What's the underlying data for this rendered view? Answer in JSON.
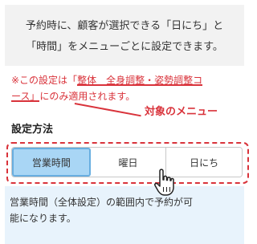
{
  "info": {
    "line1": "予約時に、顧客が選択できる「日にち」と",
    "line2": "「時間」をメニューごとに設定できます。"
  },
  "note": {
    "prefix": "※この設定は「",
    "highlight_line1": "整体　全身調整・姿勢調整コ",
    "highlight_line2": "ース」",
    "suffix": "にのみ適用されます。"
  },
  "callout": "対象のメニュー",
  "section_title": "設定方法",
  "segments": [
    {
      "label": "営業時間",
      "active": true
    },
    {
      "label": "曜日",
      "active": false
    },
    {
      "label": "日にち",
      "active": false
    }
  ],
  "description": {
    "line1": "営業時間（全体設定）の範囲内で予約が可",
    "line2": "能になります。"
  },
  "colors": {
    "accent_red": "#d9333b",
    "active_segment": "#a9d6f5",
    "info_bg": "#f2f2f2",
    "desc_bg": "#e8f3fc"
  },
  "cursor_icon": "hand-pointer-icon"
}
